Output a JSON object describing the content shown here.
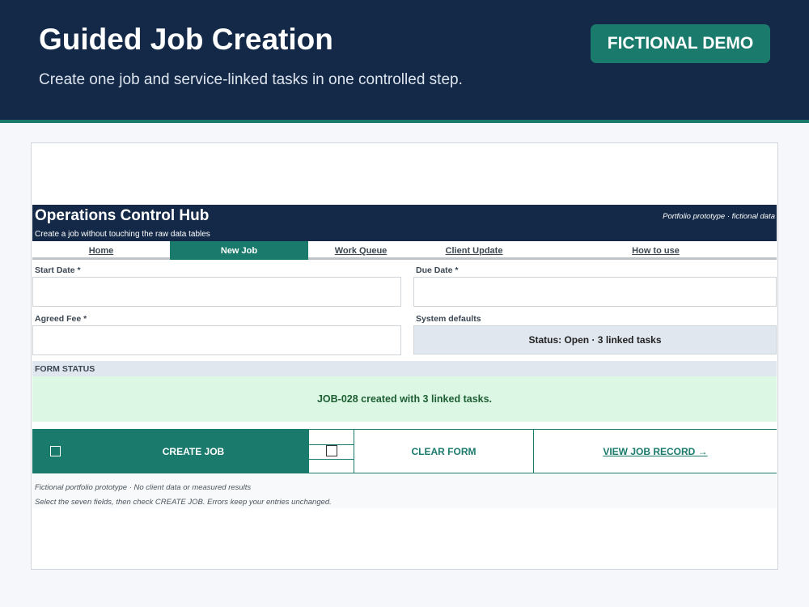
{
  "hero": {
    "title": "Guided Job Creation",
    "subtitle": "Create one job and service-linked tasks in one controlled step.",
    "badge": "FICTIONAL DEMO"
  },
  "app": {
    "title": "Operations Control Hub",
    "subtitle": "Create a job without touching the raw data tables",
    "note": "Portfolio prototype · fictional data"
  },
  "nav": {
    "items": [
      {
        "label": "Home"
      },
      {
        "label": "New Job"
      },
      {
        "label": "Work Queue"
      },
      {
        "label": "Client Update"
      },
      {
        "label": "How to use"
      }
    ],
    "active": "New Job"
  },
  "form": {
    "start_date_label": "Start Date *",
    "start_date_value": "",
    "due_date_label": "Due Date *",
    "due_date_value": "",
    "agreed_fee_label": "Agreed Fee *",
    "agreed_fee_value": "",
    "defaults_label": "System defaults",
    "defaults_value": "Status: Open · 3 linked tasks"
  },
  "form_status": {
    "heading": "FORM STATUS",
    "message": "JOB-028 created with 3 linked tasks."
  },
  "actions": {
    "create_label": "CREATE JOB",
    "clear_label": "CLEAR FORM",
    "view_label": "VIEW JOB RECORD →"
  },
  "footer": {
    "line1": "Fictional portfolio prototype · No client data or measured results",
    "line2": "Select the seven fields, then check CREATE JOB. Errors keep your entries unchanged."
  },
  "colors": {
    "navy": "#132947",
    "teal": "#1a7a6c",
    "success_bg": "#dcf8e4",
    "success_text": "#1d5e33"
  }
}
